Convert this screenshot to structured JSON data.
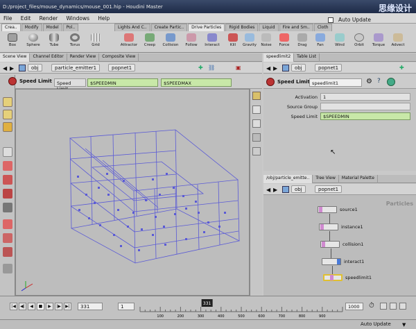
{
  "window": {
    "title": "D:/project_files/mouse_dynamics/mouse_001.hip - Houdini Master",
    "watermark": "思缘设计"
  },
  "menu": [
    "File",
    "Edit",
    "Render",
    "Windows",
    "Help"
  ],
  "autosave_label": "Auto Update",
  "shelf": {
    "tabs_left": [
      "Crea..",
      "Modify",
      "Model",
      "Pol.."
    ],
    "tabs_right": [
      "Lights And C..",
      "Create Partic..",
      "Drive Particles",
      "Rigid Bodies",
      "Liquid",
      "Fire and Sm..",
      "Cloth"
    ],
    "tools_left": [
      "Box",
      "Sphere",
      "Tube",
      "Torus",
      "Grid"
    ],
    "tools_right": [
      "Attractor",
      "Creep",
      "Collision",
      "Follow",
      "Interact",
      "Kill",
      "Gravity",
      "Noise",
      "Force",
      "Drag",
      "Fan",
      "Wind",
      "Orbit",
      "Torque",
      "Advect"
    ]
  },
  "left_tabs": [
    "Scene View",
    "Channel Editor",
    "Render View",
    "Composite View"
  ],
  "left_path": [
    "obj",
    "particle_emitter1",
    "popnet1"
  ],
  "op": {
    "name": "Speed Limit",
    "button": "Speed Limit",
    "field1": "$SPEEDMIN",
    "field2": "$SPEEDMAX"
  },
  "right_tabs": [
    "speedlimit2",
    "Table List"
  ],
  "right_path": [
    "obj",
    "popnet1"
  ],
  "param": {
    "name": "Speed Limit",
    "node_name": "speedlimit1",
    "rows": [
      {
        "label": "Activation",
        "value": "1"
      },
      {
        "label": "Source Group",
        "value": ""
      },
      {
        "label": "Speed Limit",
        "value": "$SPEEDMIN"
      }
    ]
  },
  "net_tabs": [
    "/obj/particle_emitte..",
    "Tree View",
    "Material Palette"
  ],
  "net_path": [
    "obj",
    "popnet1"
  ],
  "net_title": "Particles",
  "nodes": [
    {
      "name": "source1",
      "color": "#d08ad0"
    },
    {
      "name": "instance1",
      "color": "#d08ad0"
    },
    {
      "name": "collision1",
      "color": "#d08ad0"
    },
    {
      "name": "interact1",
      "color": "#4a7ad8"
    },
    {
      "name": "speedlimit1",
      "color": "#d08ad0"
    }
  ],
  "timeline": {
    "current_frame": "331",
    "step": "1",
    "end_frame": "1000",
    "ticks": [
      "100",
      "200",
      "300",
      "400",
      "500",
      "600",
      "700",
      "800",
      "900"
    ],
    "marker": "331"
  },
  "status": {
    "mode": "Auto Update"
  }
}
